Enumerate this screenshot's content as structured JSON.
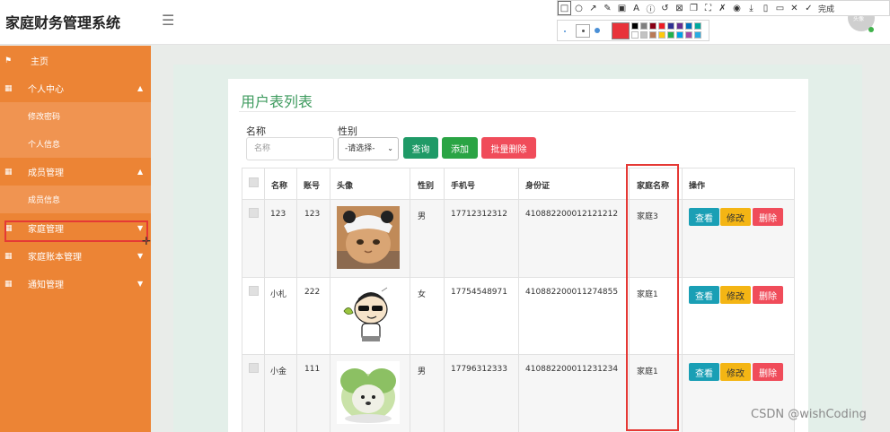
{
  "header": {
    "title": "家庭财务管理系统",
    "avatar_text": "头像",
    "menu_icon": "hamburger-icon"
  },
  "snip_tool": {
    "tools": [
      "rect-icon",
      "ellipse-icon",
      "arrow-icon",
      "pen-icon",
      "mosaic-icon",
      "text-icon",
      "info-icon",
      "undo-icon",
      "save-icon",
      "copy-icon",
      "fullscreen-icon",
      "pin-icon",
      "record-icon",
      "download-icon",
      "phone-icon",
      "bookmark-icon",
      "close-icon",
      "check-icon"
    ],
    "done_label": "完成",
    "current_color": "#e8333a",
    "swatches": [
      "#000000",
      "#7f7f7f",
      "#880015",
      "#ed1c24",
      "#2e3192",
      "#662d91",
      "#0072bc",
      "#00a99d",
      "#ffffff",
      "#c3c3c3",
      "#b97a57",
      "#ffc90e",
      "#22b14c",
      "#00a2e8",
      "#a349a4",
      "#29abe2"
    ]
  },
  "sidebar": {
    "items": [
      {
        "label": "主页",
        "icon": "flag-icon"
      },
      {
        "label": "个人中心",
        "icon": "grid-icon",
        "chevron": "▲"
      },
      {
        "label": "修改密码"
      },
      {
        "label": "个人信息"
      },
      {
        "label": "成员管理",
        "icon": "grid-icon",
        "chevron": "▲"
      },
      {
        "label": "成员信息"
      },
      {
        "label": "家庭管理",
        "icon": "grid-icon",
        "chevron": "▼"
      },
      {
        "label": "家庭账本管理",
        "icon": "grid-icon",
        "chevron": "▼"
      },
      {
        "label": "通知管理",
        "icon": "grid-icon",
        "chevron": "▼"
      }
    ]
  },
  "main": {
    "title": "用户表列表",
    "search": {
      "name_label": "名称",
      "name_placeholder": "名称",
      "gender_label": "性别",
      "gender_selected": "-请选择-"
    },
    "buttons": {
      "query": "查询",
      "add": "添加",
      "batch_delete": "批量删除"
    },
    "table": {
      "headers": [
        "名称",
        "账号",
        "头像",
        "性别",
        "手机号",
        "身份证",
        "家庭名称",
        "操作"
      ],
      "rows": [
        {
          "name": "123",
          "account": "123",
          "avatar": "cat-with-panda-hat",
          "gender": "男",
          "phone": "17712312312",
          "id_card": "410882200012121212",
          "family": "家庭3"
        },
        {
          "name": "小札",
          "account": "222",
          "avatar": "cartoon-boy-with-sunglasses",
          "gender": "女",
          "phone": "17754548971",
          "id_card": "410882200011274855",
          "family": "家庭1"
        },
        {
          "name": "小金",
          "account": "111",
          "avatar": "cabbage-dog",
          "gender": "男",
          "phone": "17796312333",
          "id_card": "410882200011231234",
          "family": "家庭1"
        }
      ],
      "actions": {
        "view": "查看",
        "edit": "修改",
        "delete": "删除"
      }
    }
  },
  "watermark": "CSDN @wishCoding",
  "colors": {
    "sidebar": "#ec8435",
    "title_green": "#3f9b5f",
    "query_button": "#1f9a67",
    "add_button": "#2aa444",
    "delete_button": "#f04c5a",
    "view_button": "#1a9fb5",
    "edit_button": "#f4b514",
    "highlight_red": "#e53935"
  }
}
